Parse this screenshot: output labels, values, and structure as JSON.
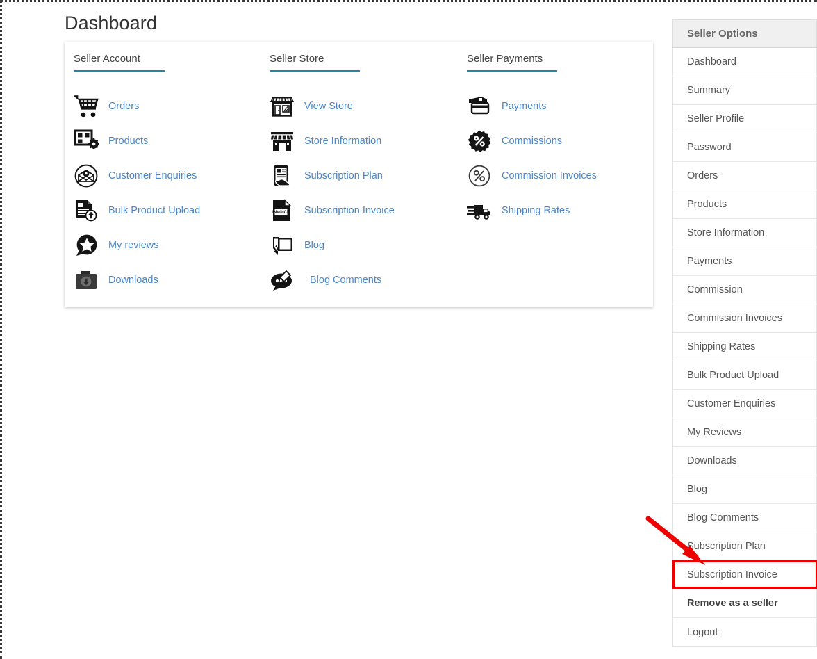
{
  "page": {
    "title": "Dashboard"
  },
  "colors": {
    "link": "#4a86c8",
    "rule": "#2186ae",
    "highlight": "#ef0000",
    "sidebar_header_bg": "#f0f0f0"
  },
  "card": {
    "columns": [
      {
        "heading": "Seller Account",
        "items": [
          {
            "label": "Orders",
            "icon": "shopping-cart-icon"
          },
          {
            "label": "Products",
            "icon": "products-gear-icon"
          },
          {
            "label": "Customer Enquiries",
            "icon": "envelope-circle-icon"
          },
          {
            "label": "Bulk Product Upload",
            "icon": "document-upload-icon"
          },
          {
            "label": "My reviews",
            "icon": "star-chat-icon"
          },
          {
            "label": "Downloads",
            "icon": "download-box-icon"
          }
        ]
      },
      {
        "heading": "Seller Store",
        "items": [
          {
            "label": "View Store",
            "icon": "storefront-view-icon"
          },
          {
            "label": "Store Information",
            "icon": "storefront-info-icon"
          },
          {
            "label": "Subscription Plan",
            "icon": "plan-document-hand-icon"
          },
          {
            "label": "Subscription Invoice",
            "icon": "invoice-document-icon"
          },
          {
            "label": "Blog",
            "icon": "blog-pencil-chat-icon"
          },
          {
            "label": "Blog Comments",
            "icon": "comment-bubble-icon"
          }
        ]
      },
      {
        "heading": "Seller Payments",
        "items": [
          {
            "label": "Payments",
            "icon": "wallet-card-icon"
          },
          {
            "label": "Commissions",
            "icon": "percent-badge-icon"
          },
          {
            "label": "Commission Invoices",
            "icon": "percent-circle-icon"
          },
          {
            "label": "Shipping Rates",
            "icon": "delivery-truck-icon"
          }
        ]
      }
    ]
  },
  "sidebar": {
    "header": "Seller Options",
    "items": [
      {
        "label": "Dashboard",
        "bold": false,
        "highlighted": false
      },
      {
        "label": "Summary",
        "bold": false,
        "highlighted": false
      },
      {
        "label": "Seller Profile",
        "bold": false,
        "highlighted": false
      },
      {
        "label": "Password",
        "bold": false,
        "highlighted": false
      },
      {
        "label": "Orders",
        "bold": false,
        "highlighted": false
      },
      {
        "label": "Products",
        "bold": false,
        "highlighted": false
      },
      {
        "label": "Store Information",
        "bold": false,
        "highlighted": false
      },
      {
        "label": "Payments",
        "bold": false,
        "highlighted": false
      },
      {
        "label": "Commission",
        "bold": false,
        "highlighted": false
      },
      {
        "label": "Commission Invoices",
        "bold": false,
        "highlighted": false
      },
      {
        "label": "Shipping Rates",
        "bold": false,
        "highlighted": false
      },
      {
        "label": "Bulk Product Upload",
        "bold": false,
        "highlighted": false
      },
      {
        "label": "Customer Enquiries",
        "bold": false,
        "highlighted": false
      },
      {
        "label": "My Reviews",
        "bold": false,
        "highlighted": false
      },
      {
        "label": "Downloads",
        "bold": false,
        "highlighted": false
      },
      {
        "label": "Blog",
        "bold": false,
        "highlighted": false
      },
      {
        "label": "Blog Comments",
        "bold": false,
        "highlighted": false
      },
      {
        "label": "Subscription Plan",
        "bold": false,
        "highlighted": false
      },
      {
        "label": "Subscription Invoice",
        "bold": false,
        "highlighted": true
      },
      {
        "label": "Remove as a seller",
        "bold": true,
        "highlighted": false
      },
      {
        "label": "Logout",
        "bold": false,
        "highlighted": false
      }
    ]
  },
  "annotation": {
    "arrow": "red-arrow-pointer",
    "target": "Subscription Invoice"
  }
}
